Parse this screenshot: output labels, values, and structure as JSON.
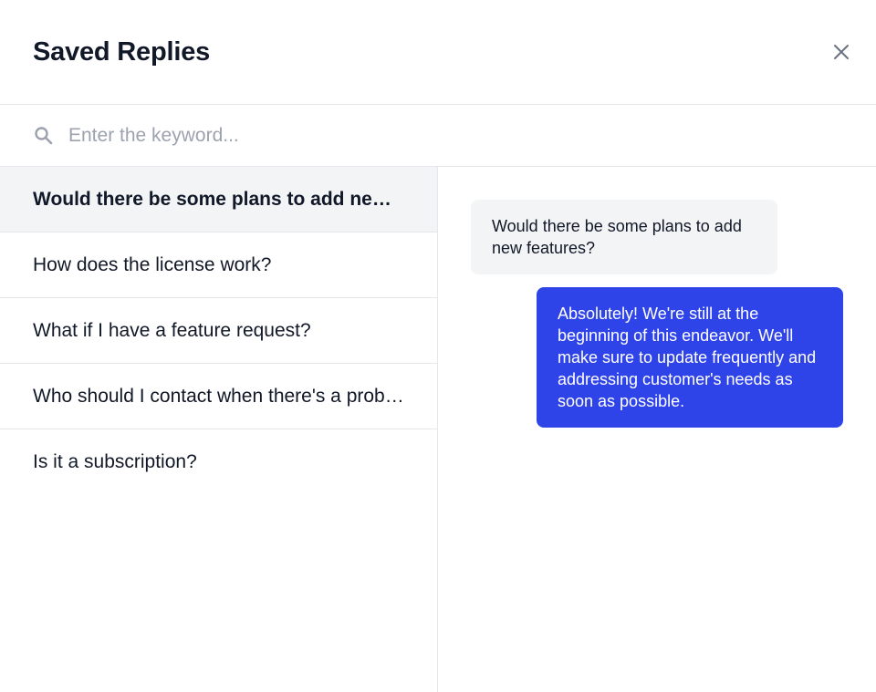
{
  "header": {
    "title": "Saved Replies",
    "close_icon": "close-icon"
  },
  "search": {
    "placeholder": "Enter the keyword...",
    "value": "",
    "icon": "search-icon"
  },
  "replies": {
    "items": [
      {
        "label": "Would there be some plans to add new features?",
        "active": true
      },
      {
        "label": "How does the license work?",
        "active": false
      },
      {
        "label": "What if I have a feature request?",
        "active": false
      },
      {
        "label": "Who should I contact when there's a problem?",
        "active": false
      },
      {
        "label": "Is it a subscription?",
        "active": false
      }
    ]
  },
  "preview": {
    "question": "Would there be some plans to add new features?",
    "answer": "Absolutely! We're still at the beginning of this endeavor. We'll make sure to update frequently and addressing customer's needs as soon as possible."
  },
  "colors": {
    "accent": "#2f44e8",
    "active_row": "#f3f4f6",
    "border": "#e5e7eb"
  }
}
